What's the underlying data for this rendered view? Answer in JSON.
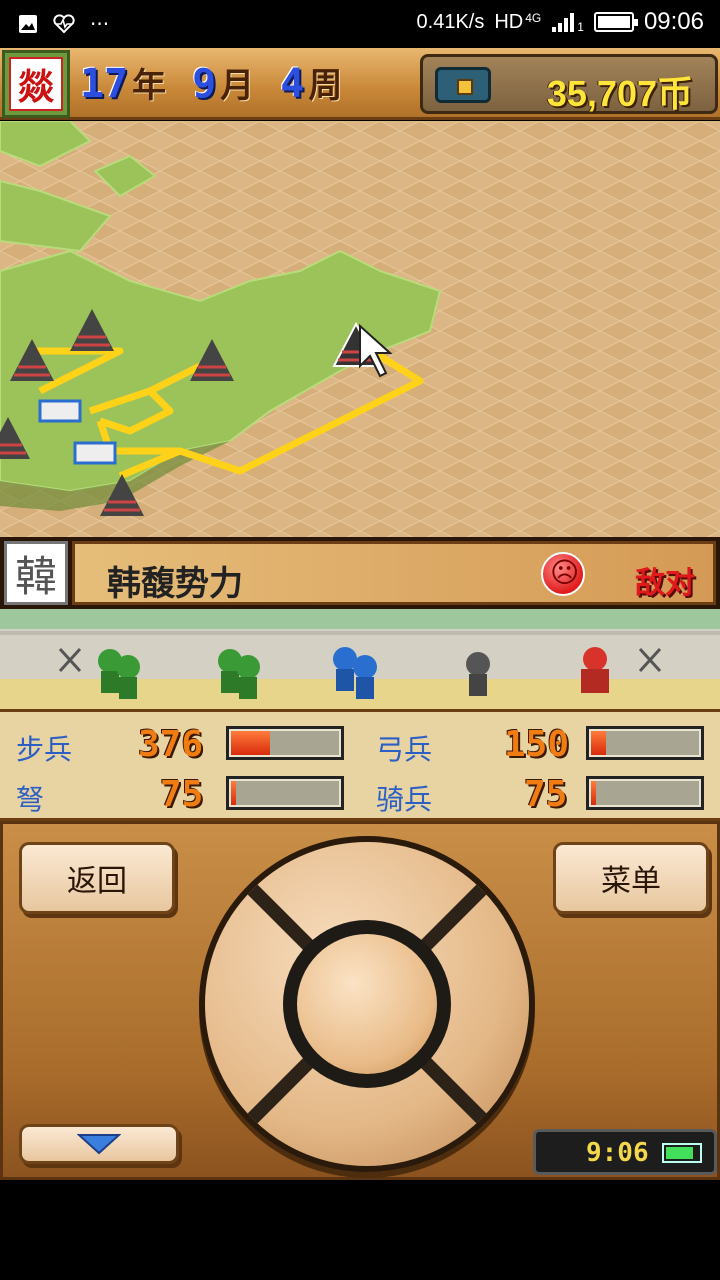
{
  "status_bar": {
    "net_speed": "0.41K/s",
    "hd": "HD",
    "network": "4G",
    "sim": "1",
    "time": "09:06",
    "icons": [
      "image-icon",
      "health-icon",
      "more-icon",
      "signal-icon",
      "battery-icon"
    ]
  },
  "hud": {
    "emblem_char": "燚",
    "year": "17",
    "year_unit": "年",
    "month": "9",
    "month_unit": "月",
    "week": "4",
    "week_unit": "周",
    "coins": "35,707币"
  },
  "faction": {
    "badge": "韓",
    "name": "韩馥势力",
    "relation": "敌对"
  },
  "stats": [
    {
      "label": "步兵",
      "value": "376",
      "fill": 0.36
    },
    {
      "label": "弓兵",
      "value": "150",
      "fill": 0.14
    },
    {
      "label": "弩",
      "value": "75",
      "fill": 0.05
    },
    {
      "label": "骑兵",
      "value": "75",
      "fill": 0.05
    }
  ],
  "controls": {
    "back_label": "返回",
    "menu_label": "菜单",
    "clock": "9:06",
    "battery_level": 0.85
  },
  "colors": {
    "accent_blue": "#2d4fe0",
    "coin_yellow": "#ffe53a",
    "enemy_red": "#e01a1a",
    "route_yellow": "#ffd21a"
  }
}
